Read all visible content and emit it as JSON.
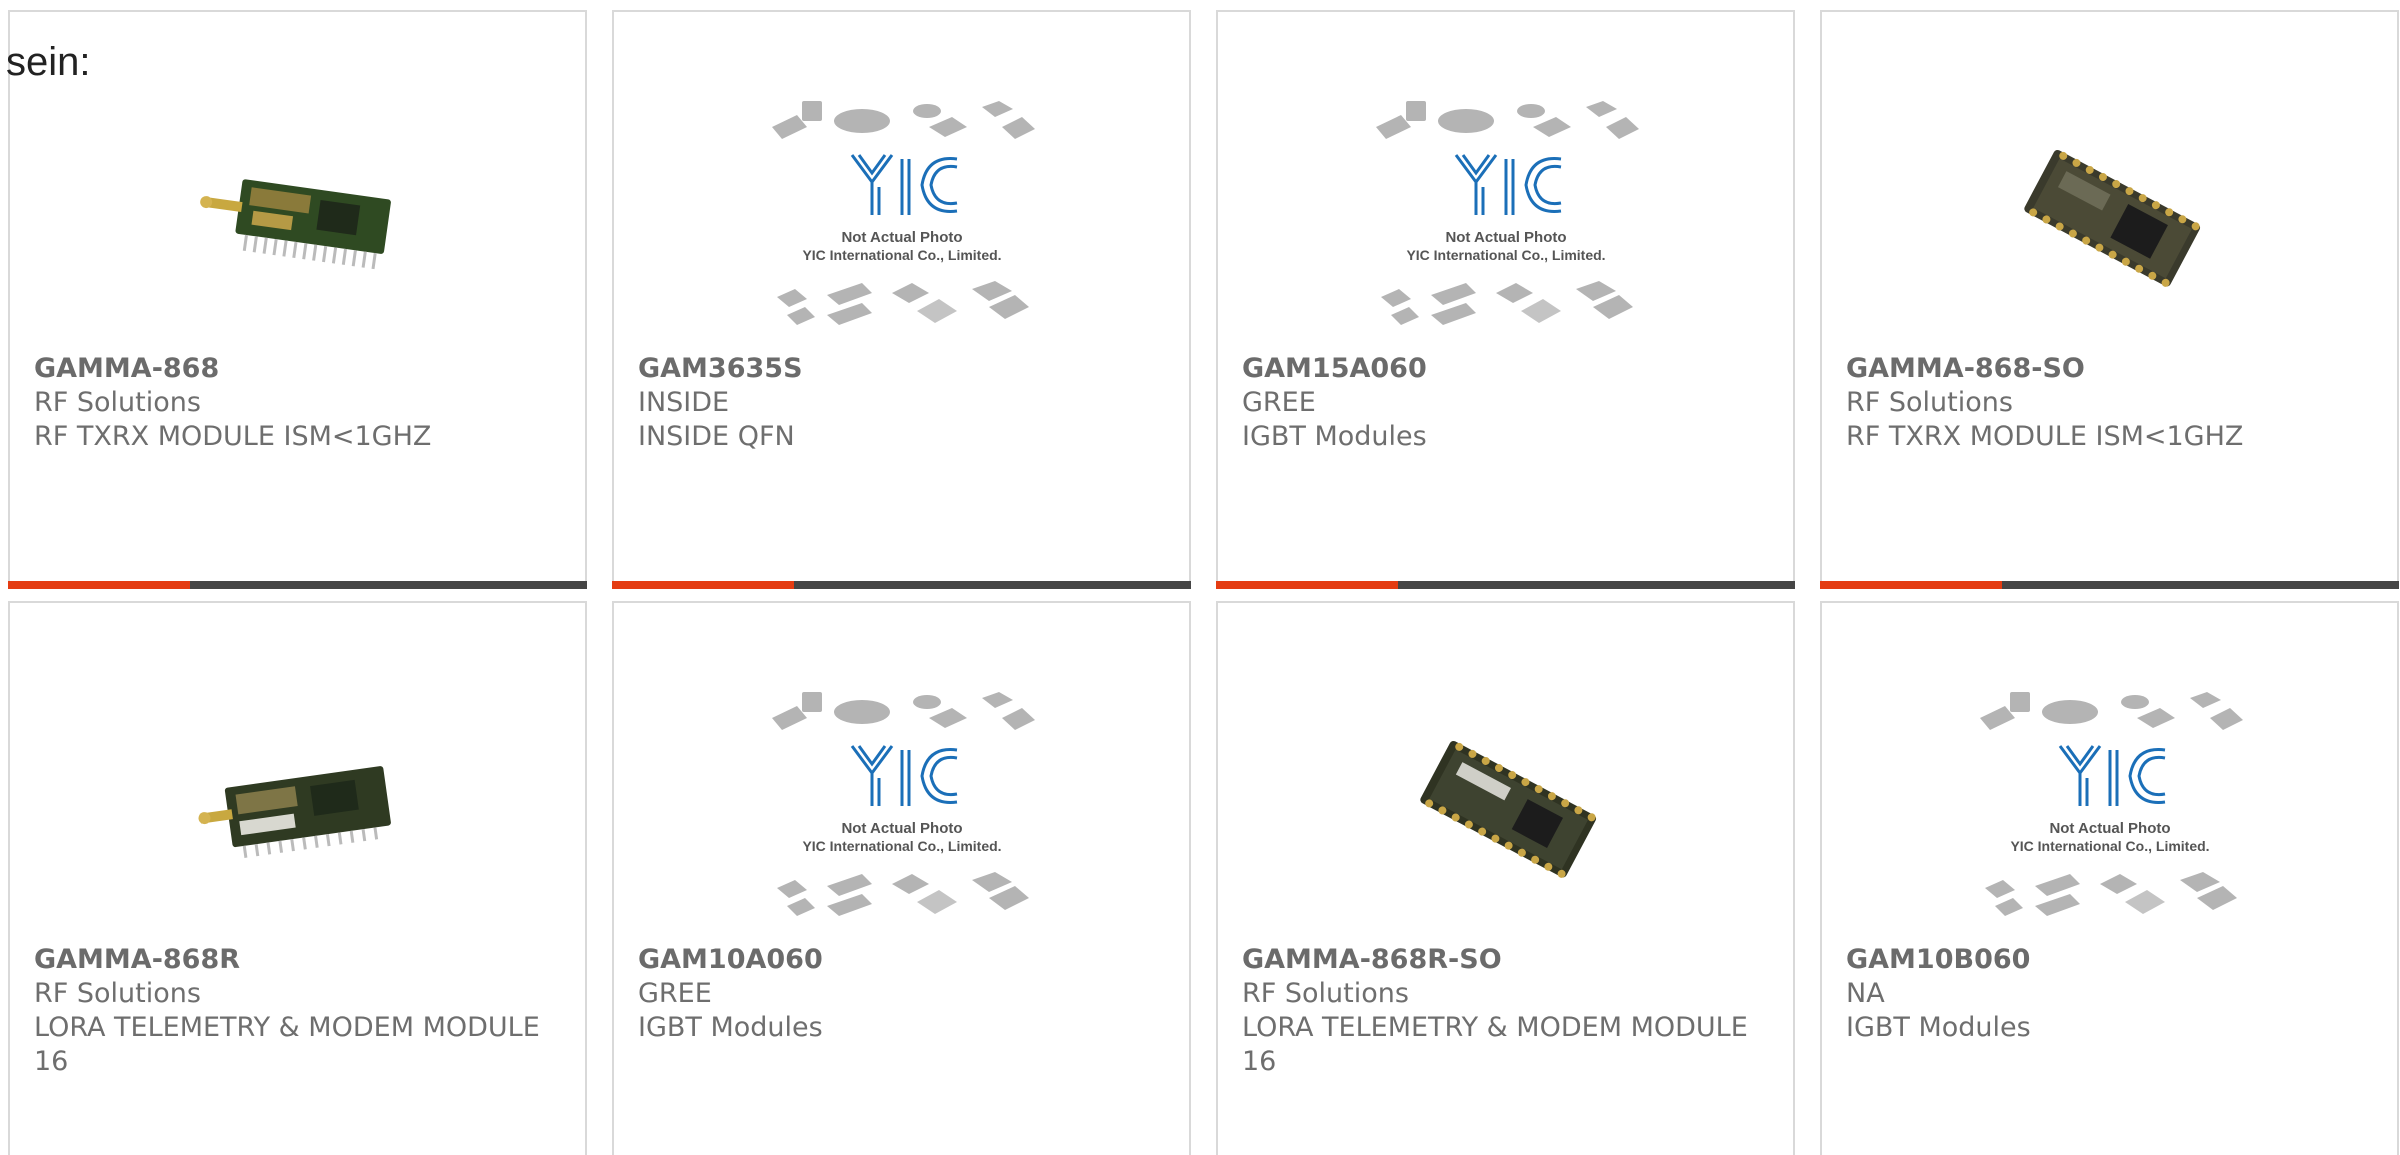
{
  "intro_text": "sein:",
  "placeholder": {
    "logo_text": "YIC",
    "line1": "Not Actual Photo",
    "line2": "YIC International Co., Limited."
  },
  "colors": {
    "accent": "#e43c12",
    "bar": "#454545",
    "border": "#d9d9d9",
    "text": "#6e6e6e",
    "logo_blue": "#1b6fb8"
  },
  "cards": [
    {
      "part_number": "GAMMA-868",
      "manufacturer": "RF Solutions",
      "description": "RF TXRX MODULE ISM<1GHZ",
      "image": "rf-module-antenna-photo"
    },
    {
      "part_number": "GAM3635S",
      "manufacturer": "INSIDE",
      "description": "INSIDE QFN",
      "image": "not-actual-photo-placeholder"
    },
    {
      "part_number": "GAM15A060",
      "manufacturer": "GREE",
      "description": "IGBT Modules",
      "image": "not-actual-photo-placeholder"
    },
    {
      "part_number": "GAMMA-868-SO",
      "manufacturer": "RF Solutions",
      "description": "RF TXRX MODULE ISM<1GHZ",
      "image": "rf-module-smd-photo"
    },
    {
      "part_number": "GAMMA-868R",
      "manufacturer": "RF Solutions",
      "description": "LORA TELEMETRY & MODEM MODULE 16",
      "image": "rf-module-antenna-photo"
    },
    {
      "part_number": "GAM10A060",
      "manufacturer": "GREE",
      "description": "IGBT Modules",
      "image": "not-actual-photo-placeholder"
    },
    {
      "part_number": "GAMMA-868R-SO",
      "manufacturer": "RF Solutions",
      "description": "LORA TELEMETRY & MODEM MODULE 16",
      "image": "rf-module-smd-photo"
    },
    {
      "part_number": "GAM10B060",
      "manufacturer": "NA",
      "description": "IGBT Modules",
      "image": "not-actual-photo-placeholder"
    }
  ]
}
